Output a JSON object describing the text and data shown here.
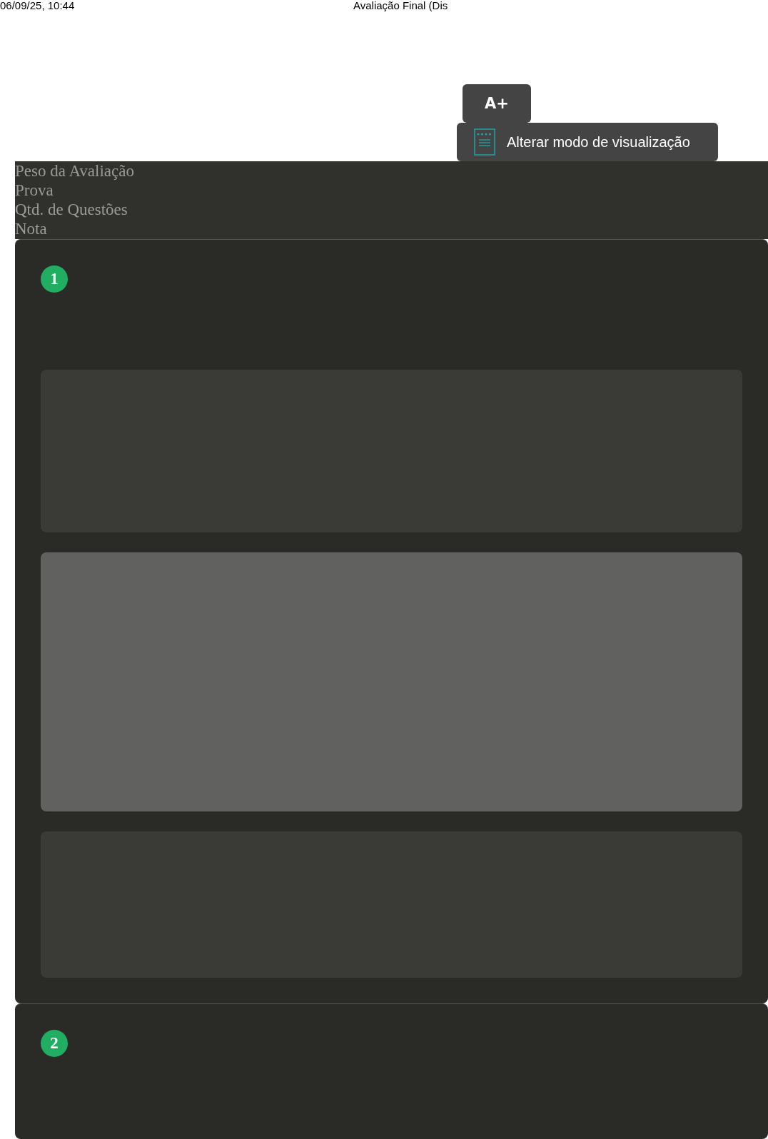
{
  "print_header": {
    "date": "06/09/25, 10:44",
    "title": "Avaliação Final (Dis"
  },
  "toolbar": [
    {
      "kind": "font",
      "label": "A+"
    },
    {
      "kind": "view",
      "label": "Alterar modo de visualização"
    }
  ],
  "info_labels": [
    "Peso da Avaliação",
    "Prova",
    "Qtd. de Questões",
    "Nota"
  ],
  "questions": [
    {
      "number": "1",
      "panels": [
        {
          "kind": "muted"
        },
        {
          "kind": "light"
        },
        {
          "kind": "muted"
        }
      ]
    },
    {
      "number": "2"
    }
  ]
}
